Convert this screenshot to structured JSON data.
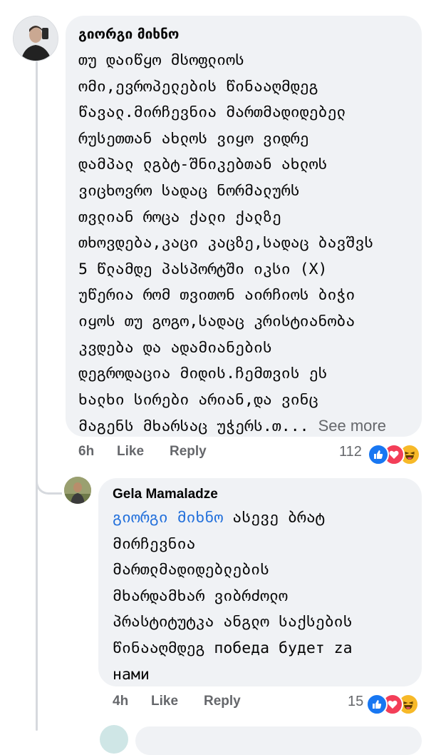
{
  "comments": [
    {
      "author": "გიორგი მიხნო",
      "lines": [
        "თუ დაიწყო მსოფლიოს",
        "ომი,ევროპელების წინააღმდეგ",
        "წავალ.მირჩევნია მართმადიდებელ",
        "რუსეთთან ახლოს ვიყო ვიდრე",
        "დამპალ ლგბტ-შნიკებთან ახლოს",
        "ვიცხოვრო სადაც ნორმალურს",
        "თვლიან როცა ქალი ქალზე",
        "თხოვდება,კაცი კაცზე,სადაც ბავშვს",
        "5 წლამდე პასპორტში იკსი (X)",
        "უწერია რომ თვითონ აირჩიოს ბიჭი",
        "იყოს თუ გოგო,სადაც კრისტიანობა",
        "კვდება და ადამიანების",
        "დეგროდაცია მიდის.ჩემთვის ეს",
        "ხალხი სირები არიან,და ვინც"
      ],
      "last_line": "მაგენს მხარსაც უჭერს.თ...",
      "see_more": "See more",
      "time": "6h",
      "like_label": "Like",
      "reply_label": "Reply",
      "reaction_count": "112",
      "reactions": [
        "like-reaction-icon",
        "love-reaction-icon",
        "haha-reaction-icon"
      ]
    },
    {
      "author": "Gela Mamaladze",
      "mention": "გიორგი მიხნო",
      "first_line_rest": " ასევე ბრატ",
      "lines": [
        "მირჩევნია",
        "მართლმადიდებლების",
        "მხარდამხარ ვიბრძოლო",
        "პრასტიტუტკა ანგლო საქსების",
        "წინააღმდეგ победа будет za",
        "нами"
      ],
      "time": "4h",
      "like_label": "Like",
      "reply_label": "Reply",
      "reaction_count": "15",
      "reactions": [
        "like-reaction-icon",
        "love-reaction-icon",
        "haha-reaction-icon"
      ]
    }
  ],
  "colors": {
    "bubble": "#f0f2f5",
    "meta_text": "#65676b",
    "mention": "#216fdb",
    "like": "#1877f2",
    "love": "#f33e58",
    "haha": "#f7b928"
  }
}
